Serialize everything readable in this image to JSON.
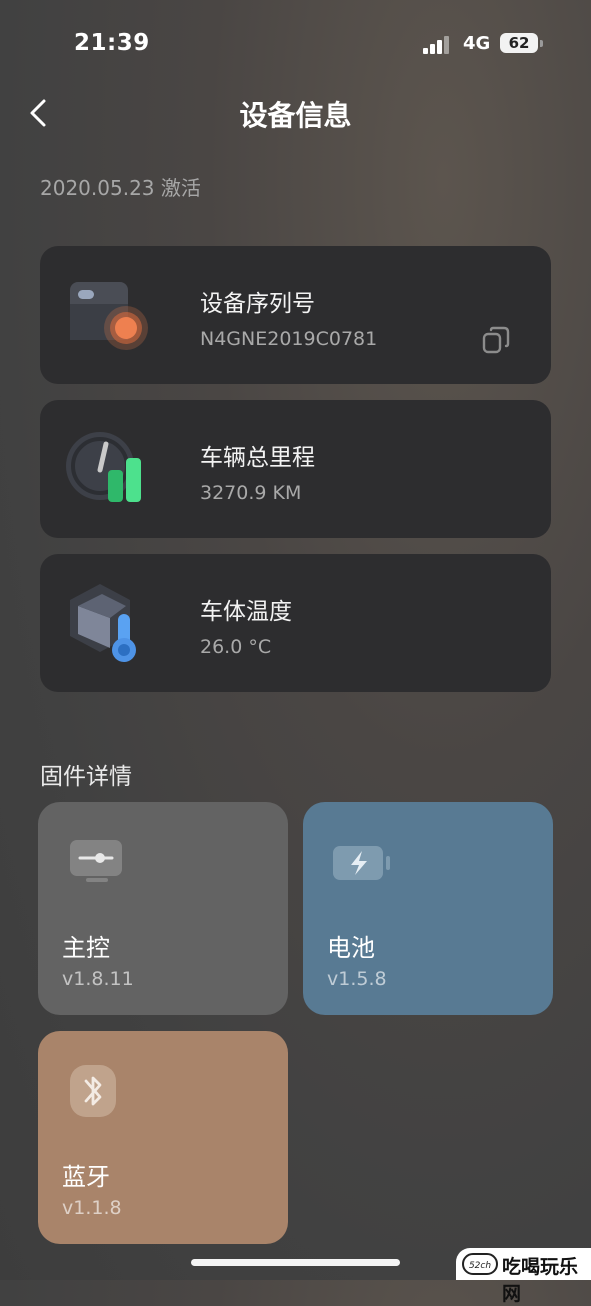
{
  "status_bar": {
    "time": "21:39",
    "network": "4G",
    "battery": "62"
  },
  "header": {
    "title": "设备信息"
  },
  "activation": "2020.05.23 激活",
  "info_cards": [
    {
      "label": "设备序列号",
      "value": "N4GNE2019C0781",
      "icon": "device-icon"
    },
    {
      "label": "车辆总里程",
      "value": "3270.9 KM",
      "icon": "odometer-icon"
    },
    {
      "label": "车体温度",
      "value": "26.0 °C",
      "icon": "thermometer-icon"
    }
  ],
  "firmware": {
    "title": "固件详情",
    "items": [
      {
        "name": "主控",
        "version": "v1.8.11",
        "icon": "controller-icon",
        "color": "#636363"
      },
      {
        "name": "电池",
        "version": "v1.5.8",
        "icon": "battery-icon",
        "color": "#587a93"
      },
      {
        "name": "蓝牙",
        "version": "v1.1.8",
        "icon": "bluetooth-icon",
        "color": "#a9846a"
      }
    ]
  },
  "watermark": {
    "badge": "52ch",
    "text": "吃喝玩乐网"
  }
}
